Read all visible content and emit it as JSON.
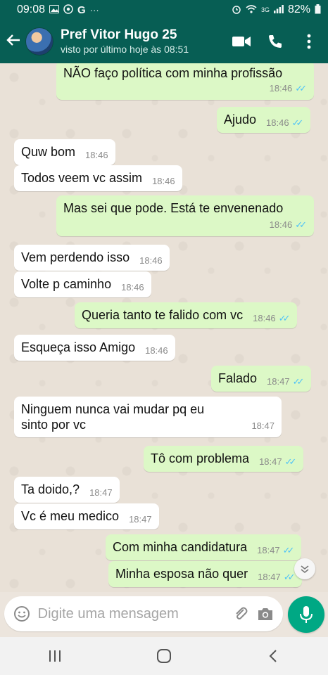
{
  "status_bar": {
    "time": "09:08",
    "battery": "82%",
    "network_label": "3G",
    "left_icons": [
      "gallery-icon",
      "whatsapp-icon",
      "google-icon",
      "more-icon"
    ],
    "right_icons": [
      "alarm-icon",
      "wifi-icon",
      "signal-icon",
      "battery-icon"
    ]
  },
  "header": {
    "contact_name": "Pref Vitor Hugo 25",
    "last_seen": "visto por último hoje às 08:51"
  },
  "colors": {
    "header": "#075e54",
    "incoming": "#ffffff",
    "outgoing": "#dcf8c6",
    "read_ticks": "#4fc3f7",
    "mic": "#00a884"
  },
  "messages": [
    {
      "dir": "out",
      "text": "NÃO  faço política  com minha profissão",
      "time": "18:46",
      "read": true
    },
    {
      "dir": "out",
      "text": "Ajudo",
      "time": "18:46",
      "read": true
    },
    {
      "dir": "in",
      "text": "Quw bom",
      "time": "18:46"
    },
    {
      "dir": "in",
      "text": "Todos veem vc assim",
      "time": "18:46"
    },
    {
      "dir": "out",
      "text": "Mas sei  que  pode. Está  te envenenado",
      "time": "18:46",
      "read": true
    },
    {
      "dir": "in",
      "text": "Vem perdendo isso",
      "time": "18:46"
    },
    {
      "dir": "in",
      "text": "Volte p caminho",
      "time": "18:46"
    },
    {
      "dir": "out",
      "text": "Queria tanto  te falido com vc",
      "time": "18:46",
      "read": true
    },
    {
      "dir": "in",
      "text": "Esqueça isso Amigo",
      "time": "18:46"
    },
    {
      "dir": "out",
      "text": "Falado",
      "time": "18:47",
      "read": true
    },
    {
      "dir": "in",
      "text": "Ninguem nunca vai mudar pq eu sinto por vc",
      "time": "18:47"
    },
    {
      "dir": "out",
      "text": "Tô  com problema",
      "time": "18:47",
      "read": true
    },
    {
      "dir": "in",
      "text": "Ta doido,?",
      "time": "18:47"
    },
    {
      "dir": "in",
      "text": "Vc é meu medico",
      "time": "18:47"
    },
    {
      "dir": "out",
      "text": "Com minha  candidatura",
      "time": "18:47",
      "read": true
    },
    {
      "dir": "out",
      "text": "Minha esposa  não quer",
      "time": "18:47",
      "read": true
    }
  ],
  "input": {
    "placeholder": "Digite uma mensagem"
  }
}
